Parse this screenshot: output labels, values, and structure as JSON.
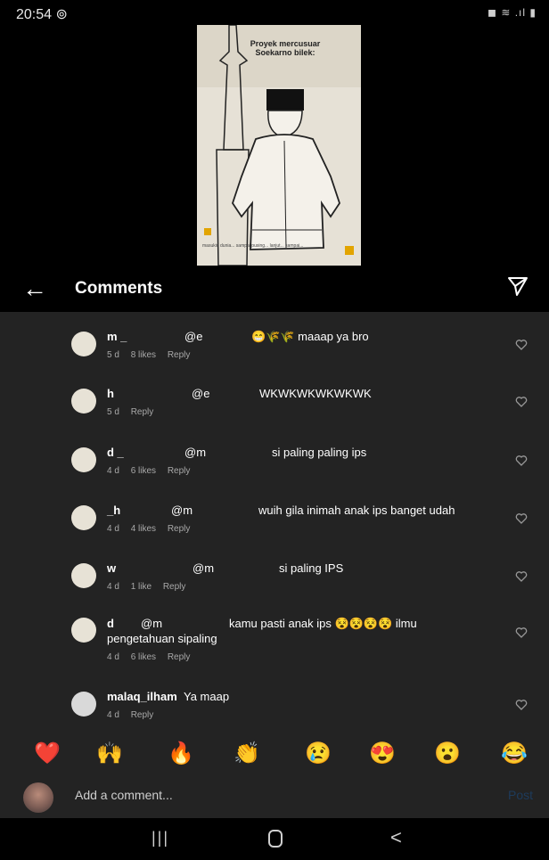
{
  "status_bar": {
    "time": "20:54 ⊚",
    "icons": "◼ ≋ .ıl ▮"
  },
  "video": {
    "caption": "Proyek mercusuar Soekarno bilek:",
    "footer": "masukin dunia... sampai pusing... lanjut... sampai..."
  },
  "header": {
    "title": "Comments",
    "back_icon": "back-arrow-icon",
    "share_icon": "send-icon"
  },
  "comments": [
    {
      "user": "m  _",
      "mention": "@e",
      "text": "😁🌾🌾 maaap ya bro",
      "meta": [
        "5 d",
        "8 likes",
        "Reply"
      ]
    },
    {
      "user": "h",
      "mention": "@e",
      "text": "WKWKWKWKWKWK",
      "meta": [
        "5 d",
        "Reply"
      ]
    },
    {
      "user": "d  _",
      "mention": "@m",
      "text": "si paling paling ips",
      "meta": [
        "4 d",
        "6 likes",
        "Reply"
      ]
    },
    {
      "user": "_h",
      "mention": "@m",
      "text": "wuih gila inimah anak ips banget udah",
      "meta": [
        "4 d",
        "4 likes",
        "Reply"
      ]
    },
    {
      "user": "w",
      "mention": "@m",
      "text": "si paling IPS",
      "meta": [
        "4 d",
        "1 like",
        "Reply"
      ]
    },
    {
      "user": "d",
      "mention": "@m",
      "text": "kamu pasti anak ips 😵😵😵😵 ilmu",
      "continuation": "pengetahuan sipaling",
      "meta": [
        "4 d",
        "6 likes",
        "Reply"
      ]
    },
    {
      "user": "malaq_ilham",
      "mention": "",
      "text": "Ya maap",
      "meta": [
        "4 d",
        "Reply"
      ]
    }
  ],
  "reactions": [
    "❤️",
    "🙌",
    "🔥",
    "👏",
    "😢",
    "😍",
    "😮",
    "😂"
  ],
  "add_comment": {
    "placeholder": "Add a comment...",
    "post_label": "Post"
  },
  "nav": {
    "recents": "|||",
    "back": "<"
  }
}
